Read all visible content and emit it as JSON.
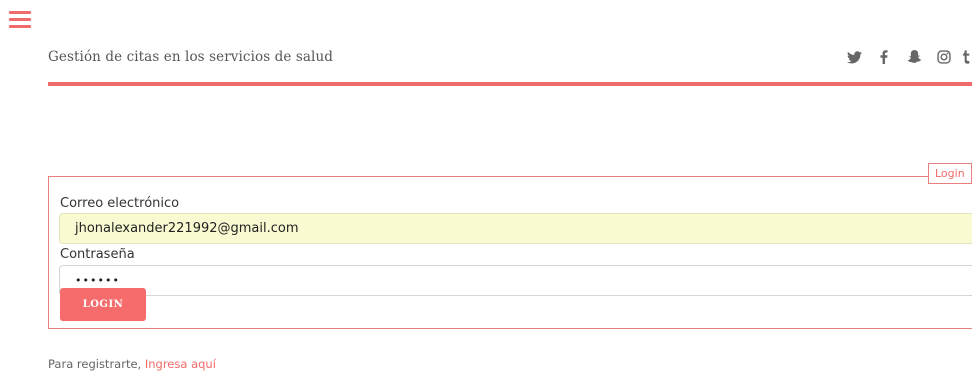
{
  "header": {
    "title": "Gestión de citas en los servicios de salud",
    "social_icons": [
      "twitter-icon",
      "facebook-icon",
      "snapchat-icon",
      "instagram-icon",
      "tumblr-icon"
    ]
  },
  "login": {
    "legend": "Login",
    "email_label": "Correo electrónico",
    "email_value": "jhonalexander221992@gmail.com",
    "password_label": "Contraseña",
    "password_value": "••••••",
    "button_label": "LOGIN"
  },
  "register": {
    "prefix": "Para registrarte,",
    "link": "Ingresa aquí"
  },
  "colors": {
    "accent": "#f06a6a",
    "autofill_bg": "#fafad2"
  }
}
